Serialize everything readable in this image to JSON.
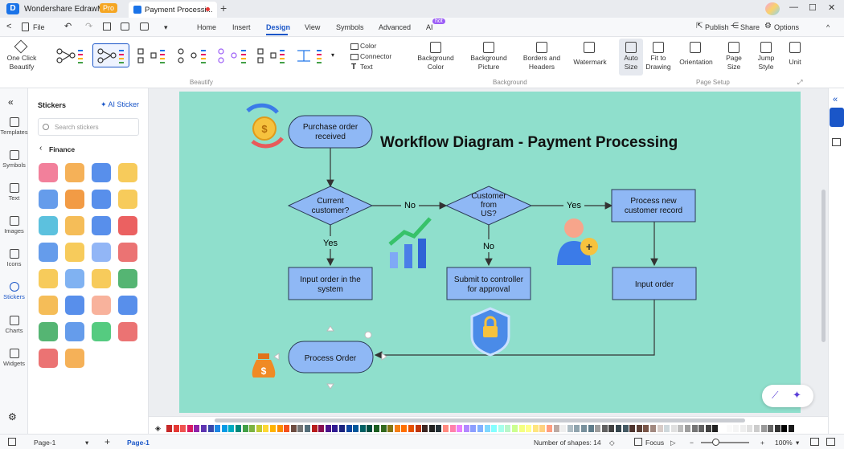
{
  "window": {
    "app_name": "Wondershare EdrawMax",
    "pro_badge": "Pro",
    "doc_tab": "Payment Processi...",
    "new_tab": "+",
    "minimize": "—",
    "maximize": "☐",
    "close": "✕"
  },
  "menu": {
    "back": "<",
    "file": "File",
    "tabs": [
      "Home",
      "Insert",
      "Design",
      "View",
      "Symbols",
      "Advanced",
      "AI"
    ],
    "active_tab": "Design",
    "hot": "hot",
    "publish": "Publish",
    "share": "Share",
    "options": "Options",
    "collapse": "^"
  },
  "ribbon": {
    "one_click_beautify": "One Click\nBeautify",
    "beautify_group": "Beautify",
    "color": "Color",
    "connector": "Connector",
    "text": "Text",
    "background_color": "Background\nColor",
    "background_picture": "Background\nPicture",
    "borders_headers": "Borders and\nHeaders",
    "watermark": "Watermark",
    "background_group": "Background",
    "auto_size": "Auto\nSize",
    "fit_to_drawing": "Fit to\nDrawing",
    "orientation": "Orientation",
    "page_size": "Page\nSize",
    "jump_style": "Jump\nStyle",
    "unit": "Unit",
    "page_setup_group": "Page Setup"
  },
  "left_rail": [
    {
      "label": "Templates"
    },
    {
      "label": "Symbols"
    },
    {
      "label": "Text"
    },
    {
      "label": "Images"
    },
    {
      "label": "Icons"
    },
    {
      "label": "Stickers"
    },
    {
      "label": "Charts"
    },
    {
      "label": "Widgets"
    }
  ],
  "stickers_panel": {
    "title": "Stickers",
    "ai_sticker": "AI Sticker",
    "search_placeholder": "Search stickers",
    "category": "Finance"
  },
  "diagram": {
    "title": "Workflow Diagram - Payment Processing",
    "nodes": {
      "purchase": "Purchase  order\nreceived",
      "current_customer": "Current\ncustomer?",
      "customer_from_us": "Customer\nfrom\nUS?",
      "process_new": "Process new\ncustomer  record",
      "input_order_system": "Input order in the\nsystem",
      "submit_controller": "Submit to controller\nfor approval",
      "input_order": "Input order",
      "process_order": "Process Order"
    },
    "edge_labels": {
      "no1": "No",
      "yes1": "Yes",
      "yes_down": "Yes",
      "no_down": "No"
    }
  },
  "status": {
    "page_selector": "Page-1",
    "add_page": "+",
    "active_page": "Page-1",
    "shape_count": "Number of shapes: 14",
    "focus": "Focus",
    "zoom": "100%"
  },
  "colors": {
    "canvas_bg": "#8fdfcc",
    "node_fill": "#8fb8f5",
    "accent": "#1a56c8"
  }
}
